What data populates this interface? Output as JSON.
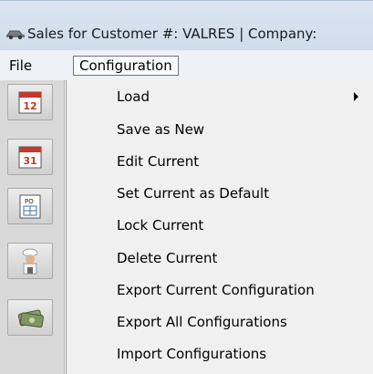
{
  "window": {
    "title": "Sales for Customer #: VALRES | Company:",
    "icon": "car-icon"
  },
  "menubar": {
    "items": [
      {
        "label": "File"
      },
      {
        "label": "Configuration",
        "active": true
      }
    ]
  },
  "left_toolbar": {
    "buttons": [
      {
        "icon": "calendar-12-icon"
      },
      {
        "icon": "calendar-31-icon"
      },
      {
        "icon": "purchase-order-icon"
      },
      {
        "icon": "chef-icon"
      },
      {
        "icon": "money-icon"
      }
    ]
  },
  "configuration_menu": {
    "items": [
      {
        "label": "Load",
        "has_submenu": true
      },
      {
        "label": "Save as New"
      },
      {
        "label": "Edit Current"
      },
      {
        "label": "Set Current as Default"
      },
      {
        "label": "Lock Current"
      },
      {
        "label": "Delete Current"
      },
      {
        "label": "Export Current Configuration"
      },
      {
        "label": "Export All Configurations"
      },
      {
        "label": "Import Configurations"
      }
    ]
  },
  "colors": {
    "menu_background": "#f0f0f0",
    "toolbar_background": "#d9d9d9",
    "active_menu_border": "#6f7480"
  }
}
